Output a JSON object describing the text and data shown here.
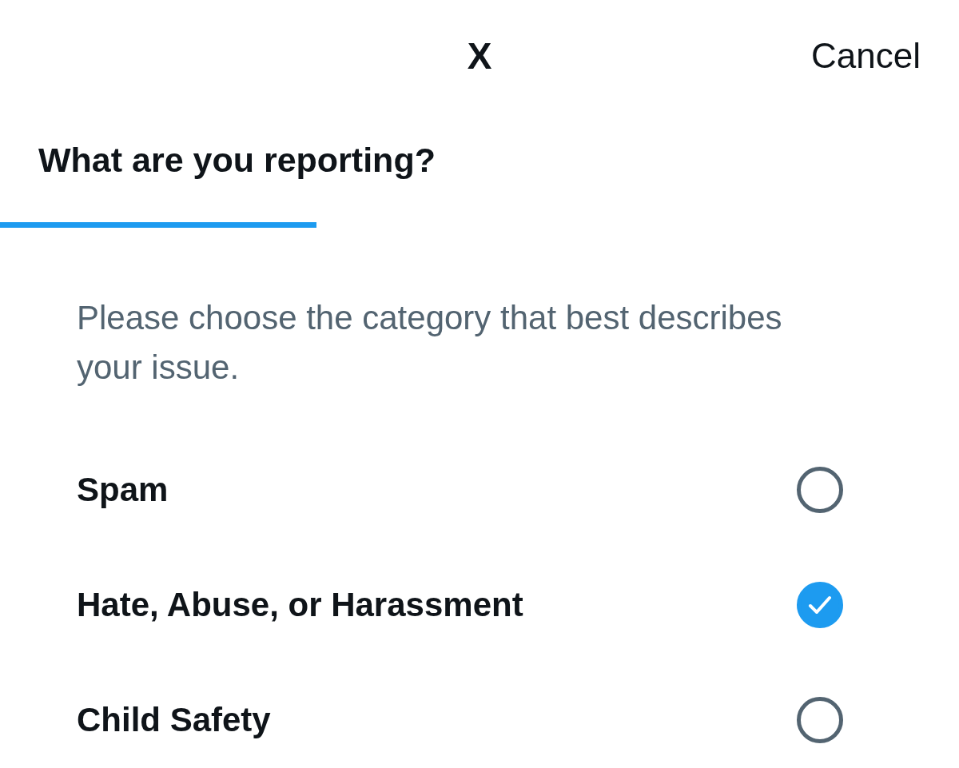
{
  "header": {
    "logo": "X",
    "cancel": "Cancel"
  },
  "title": "What are you reporting?",
  "progress": {
    "level": 0.33
  },
  "description": "Please choose the category that best describes your issue.",
  "options": [
    {
      "label": "Spam",
      "selected": false
    },
    {
      "label": "Hate, Abuse, or Harassment",
      "selected": true
    },
    {
      "label": "Child Safety",
      "selected": false
    }
  ]
}
